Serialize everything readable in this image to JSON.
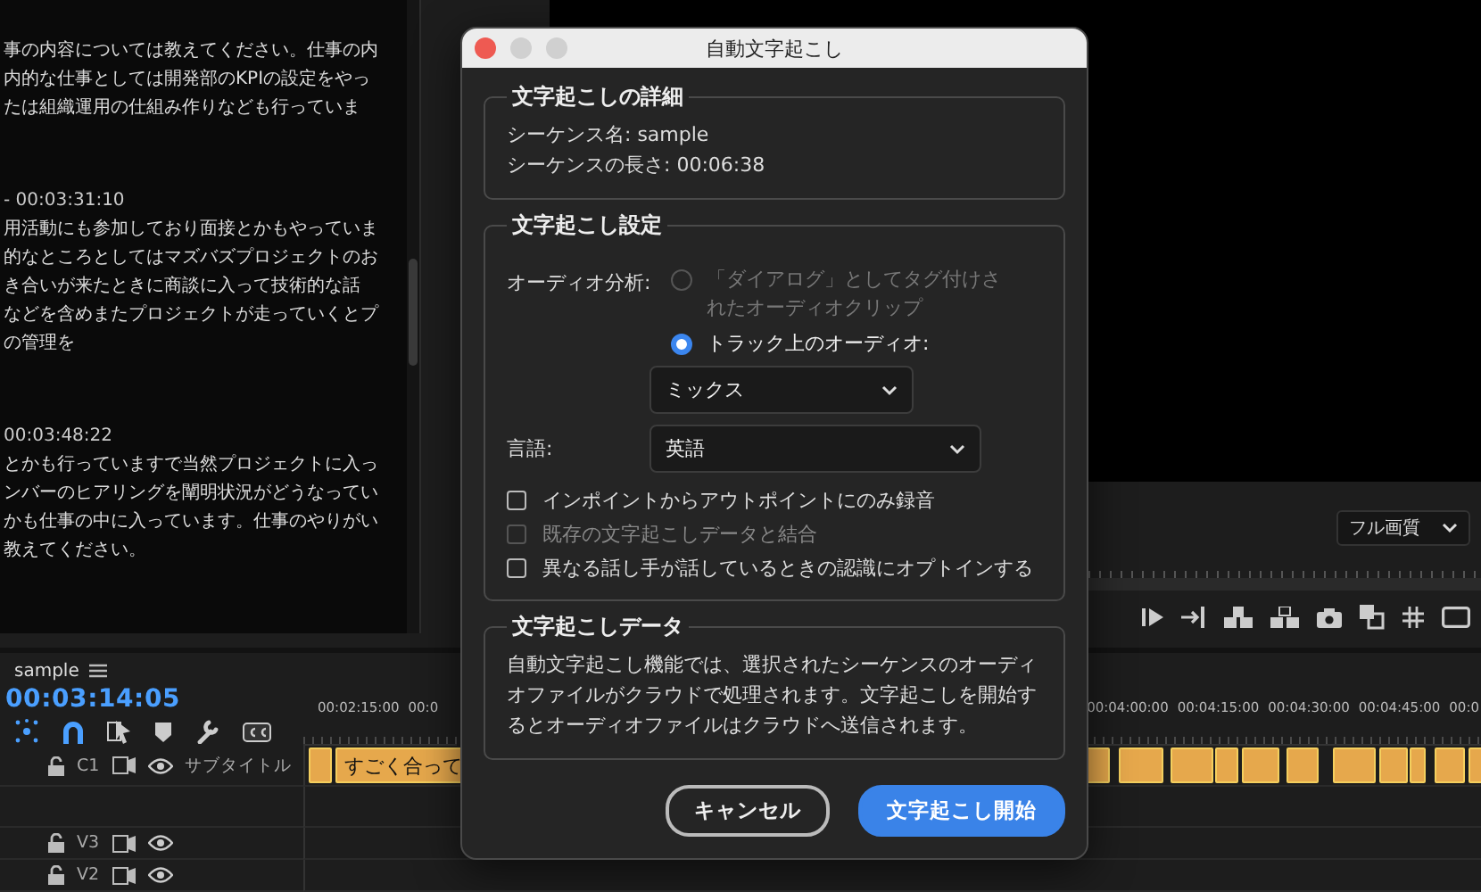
{
  "transcript": {
    "blocks": [
      {
        "lines": [
          "事の内容については教えてください。仕事の内",
          "内的な仕事としては開発部のKPIの設定をやっ",
          "たは組織運用の仕組み作りなども行っていま"
        ]
      },
      {
        "timecode": "- 00:03:31:10",
        "lines": [
          "用活動にも参加しており面接とかもやっていま",
          "的なところとしてはマズバズプロジェクトのお",
          "き合いが来たときに商談に入って技術的な話",
          "などを含めまたプロジェクトが走っていくとプ",
          "の管理を"
        ]
      },
      {
        "timecode": "00:03:48:22",
        "lines": [
          "とかも行っていますで当然プロジェクトに入っ",
          "ンバーのヒアリングを闡明状況がどうなってい",
          "かも仕事の中に入っています。仕事のやりがい",
          "教えてください。"
        ]
      }
    ]
  },
  "program_monitor": {
    "quality": "フル画質"
  },
  "timeline": {
    "sequence_tab": "sample",
    "timecode": "00:03:14:05",
    "ruler_left": [
      "00:02:15:00",
      "00:0"
    ],
    "ruler_right": [
      "00:04:00:00",
      "00:04:15:00",
      "00:04:30:00",
      "00:04:45:00",
      "00:0"
    ],
    "tracks": [
      {
        "kind": "caption",
        "name": "C1",
        "label": "サブタイトル",
        "clip_text": "すごく合って"
      },
      {
        "kind": "empty"
      },
      {
        "kind": "video",
        "name": "V3"
      },
      {
        "kind": "video",
        "name": "V2"
      }
    ]
  },
  "dialog": {
    "title": "自動文字起こし",
    "details": {
      "heading": "文字起こしの詳細",
      "lines": [
        "シーケンス名: sample",
        "シーケンスの長さ: 00:06:38"
      ]
    },
    "settings": {
      "heading": "文字起こし設定",
      "audio_label": "オーディオ分析:",
      "radios": [
        {
          "label": "「ダイアログ」としてタグ付けされたオーディオクリップ",
          "selected": false,
          "disabled": true
        },
        {
          "label": "トラック上のオーディオ:",
          "selected": true,
          "disabled": false
        }
      ],
      "audio_dropdown": "ミックス",
      "language_label": "言語:",
      "language_dropdown": "英語",
      "checkboxes": [
        {
          "label": "インポイントからアウトポイントにのみ録音",
          "checked": false,
          "disabled": false
        },
        {
          "label": "既存の文字起こしデータと結合",
          "checked": false,
          "disabled": true
        },
        {
          "label": "異なる話し手が話しているときの認識にオプトインする",
          "checked": false,
          "disabled": false
        }
      ]
    },
    "data": {
      "heading": "文字起こしデータ",
      "text": "自動文字起こし機能では、選択されたシーケンスのオーディオファイルがクラウドで処理されます。文字起こしを開始するとオーディオファイルはクラウドへ送信されます。"
    },
    "buttons": [
      {
        "label": "キャンセル",
        "kind": "secondary"
      },
      {
        "label": "文字起こし開始",
        "kind": "primary"
      }
    ]
  }
}
